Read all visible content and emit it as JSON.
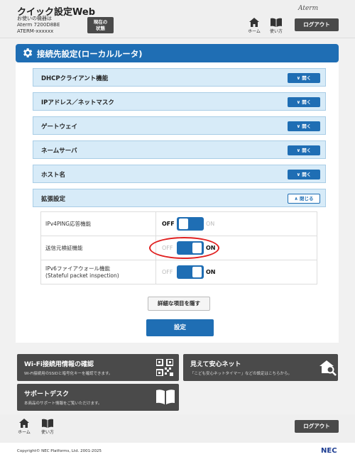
{
  "header": {
    "app_title": "クイック設定Web",
    "device_line1": "お使いの機器は",
    "device_line2": "Aterm 7200D8BE",
    "device_line3": "ATERM-xxxxxx",
    "status_line1": "現在の",
    "status_line2": "状態",
    "brand": "Aterm",
    "home_label": "ホーム",
    "howto_label": "使い方",
    "logout_label": "ログアウト"
  },
  "section": {
    "title": "接続先設定(ローカルルータ)"
  },
  "accordions": [
    {
      "label": "DHCPクライアント機能",
      "button": "開く"
    },
    {
      "label": "IPアドレス／ネットマスク",
      "button": "開く"
    },
    {
      "label": "ゲートウェイ",
      "button": "開く"
    },
    {
      "label": "ネームサーバ",
      "button": "開く"
    },
    {
      "label": "ホスト名",
      "button": "開く"
    },
    {
      "label": "拡張設定",
      "button": "閉じる"
    }
  ],
  "settings": [
    {
      "name_line1": "IPv4PING応答機能",
      "name_line2": "",
      "off": "OFF",
      "on": "ON",
      "state": "OFF"
    },
    {
      "name_line1": "送信元検証機能",
      "name_line2": "",
      "off": "OFF",
      "on": "ON",
      "state": "ON"
    },
    {
      "name_line1": "IPv6ファイアウォール機能",
      "name_line2": "(Stateful packet inspection)",
      "off": "OFF",
      "on": "ON",
      "state": "ON"
    }
  ],
  "buttons": {
    "hide_details": "詳細な項目を隠す",
    "save": "設定"
  },
  "cards": {
    "wifi_title": "Wi-Fi接続用情報の確認",
    "wifi_desc": "Wi-Fi接続用のSSIDと暗号化キーを確認できます。",
    "safety_title": "見えて安心ネット",
    "safety_desc": "「こども安心ネットタイマー」などの設定はこちらから。",
    "support_title": "サポートデスク",
    "support_desc": "本商品のサポート情報をご覧いただけます。"
  },
  "footer": {
    "home_label": "ホーム",
    "howto_label": "使い方",
    "logout_label": "ログアウト",
    "copyright": "Copyright© NEC Platforms, Ltd. 2001-2025",
    "nec": "NEC"
  },
  "colors": {
    "accent": "#1f6eb4",
    "accordion_bg": "#d7ebf8",
    "highlight": "#e02020"
  }
}
